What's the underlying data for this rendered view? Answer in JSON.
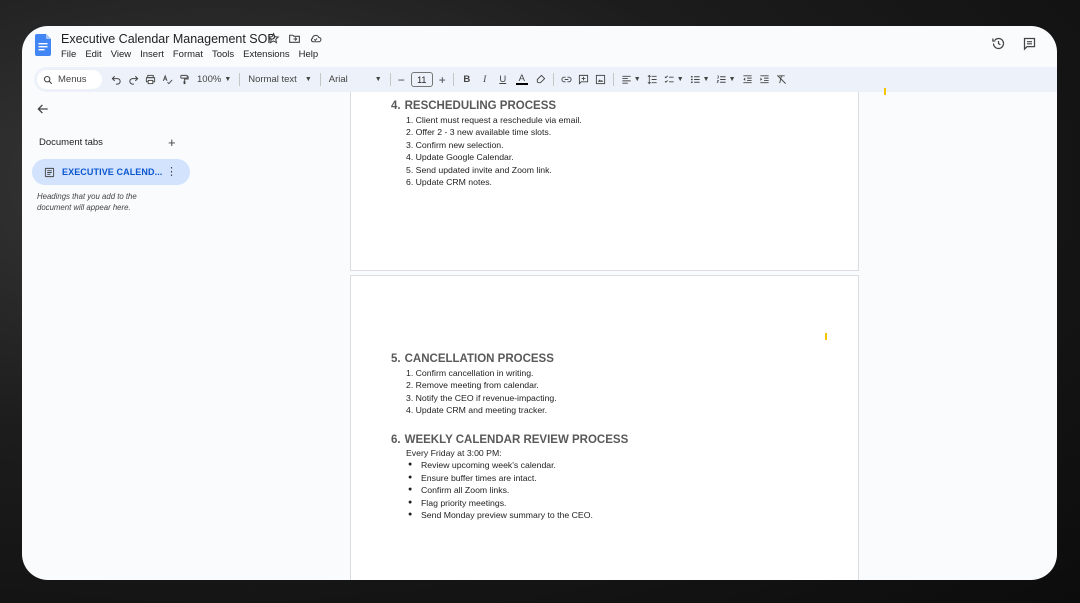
{
  "app": {
    "title": "Executive Calendar Management SOP",
    "menu": [
      "File",
      "Edit",
      "View",
      "Insert",
      "Format",
      "Tools",
      "Extensions",
      "Help"
    ]
  },
  "toolbar": {
    "search_label": "Menus",
    "zoom": "100%",
    "style": "Normal text",
    "font": "Arial",
    "font_size": "11",
    "bold": "B",
    "italic": "I",
    "underline": "U",
    "text_color": "A"
  },
  "sidebar": {
    "tabs_label": "Document tabs",
    "add": "+",
    "active_tab": "EXECUTIVE CALEND...",
    "hint": "Headings that you add to the document will appear here."
  },
  "document": {
    "section4": {
      "number": "4.",
      "heading": "RESCHEDULING PROCESS",
      "items": [
        "1. Client must request a reschedule via email.",
        "2. Offer 2 - 3 new available time slots.",
        "3. Confirm new selection.",
        "4. Update Google Calendar.",
        "5. Send updated invite and Zoom link.",
        "6. Update CRM notes."
      ]
    },
    "section5": {
      "number": "5.",
      "heading": "CANCELLATION PROCESS",
      "items": [
        "1. Confirm cancellation in writing.",
        "2. Remove meeting from calendar.",
        "3. Notify the CEO if revenue-impacting.",
        "4. Update CRM and meeting tracker."
      ]
    },
    "section6": {
      "number": "6.",
      "heading": "WEEKLY CALENDAR REVIEW PROCESS",
      "intro": "Every Friday at 3:00 PM:",
      "items": [
        "Review upcoming week's calendar.",
        "Ensure buffer times are intact.",
        "Confirm all Zoom links.",
        "Flag priority meetings.",
        "Send Monday preview summary to the CEO."
      ]
    }
  },
  "colors": {
    "accent": "#0b57d0",
    "tab_bg": "#d3e3fd",
    "toolbar_bg": "#edf2fa",
    "heading": "#595959"
  }
}
